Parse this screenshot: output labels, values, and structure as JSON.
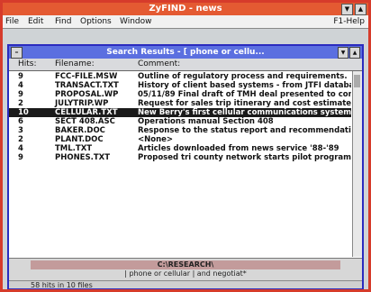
{
  "app": {
    "title": "ZyFIND - news"
  },
  "menu": {
    "file": "File",
    "edit": "Edit",
    "find": "Find",
    "options": "Options",
    "window": "Window",
    "help": "F1-Help"
  },
  "results_window": {
    "title": "Search Results - [ phone or cellu...",
    "columns": {
      "hits": "Hits:",
      "filename": "Filename:",
      "comment": "Comment:"
    },
    "rows": [
      {
        "hits": "9",
        "filename": "FCC-FILE.MSW",
        "comment": "Outline of regulatory process and requirements."
      },
      {
        "hits": "4",
        "filename": "TRANSACT.TXT",
        "comment": "History of client based systems - from JTFI database."
      },
      {
        "hits": "9",
        "filename": "PROPOSAL.WP",
        "comment": "05/11/89 Final draft of TMH deal presented to committee."
      },
      {
        "hits": "2",
        "filename": "JULYTRIP.WP",
        "comment": "Request for sales trip itinerary and cost estimates."
      },
      {
        "hits": "10",
        "filename": "CELLULAR.TXT",
        "comment": "New Berry's first cellular communications system started."
      },
      {
        "hits": "6",
        "filename": "SECT 408.ASC",
        "comment": "Operations manual  Section 408"
      },
      {
        "hits": "3",
        "filename": "BAKER.DOC",
        "comment": "Response to the status report and recommendations."
      },
      {
        "hits": "2",
        "filename": "PLANT.DOC",
        "comment": "<None>"
      },
      {
        "hits": "4",
        "filename": "TML.TXT",
        "comment": "Articles downloaded from news service '88-'89"
      },
      {
        "hits": "9",
        "filename": "PHONES.TXT",
        "comment": "Proposed tri county network starts pilot program."
      }
    ],
    "selected_row": 4
  },
  "search_panel": {
    "label": "C:\\RESEARCH\\",
    "query": "| phone or cellular | and negotiat*"
  },
  "status": {
    "text": "58 hits in 10 files"
  }
}
